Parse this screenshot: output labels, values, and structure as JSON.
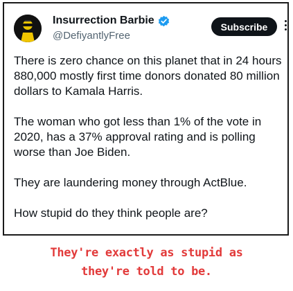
{
  "tweet": {
    "author": {
      "display_name": "Insurrection Barbie",
      "handle": "@DefiyantlyFree",
      "verified": true,
      "avatar_icon": "avatar-icon"
    },
    "subscribe_label": "Subscribe",
    "more_icon": "more-options-icon",
    "paragraphs": [
      "There is zero chance on this planet that in 24 hours 880,000 mostly first time donors donated 80 million dollars to Kamala Harris.",
      "The woman who got less than 1% of the vote in 2020, has a 37% approval rating and is polling worse than Joe Biden.",
      "They are laundering money through ActBlue.",
      "How stupid do they think people are?"
    ]
  },
  "caption": {
    "line1": "They're exactly as stupid as",
    "line2": "they're told to be.",
    "color": "#e23a3a"
  },
  "colors": {
    "verified": "#1d9bf0",
    "subscribe_bg": "#0f1419",
    "handle": "#536471"
  }
}
